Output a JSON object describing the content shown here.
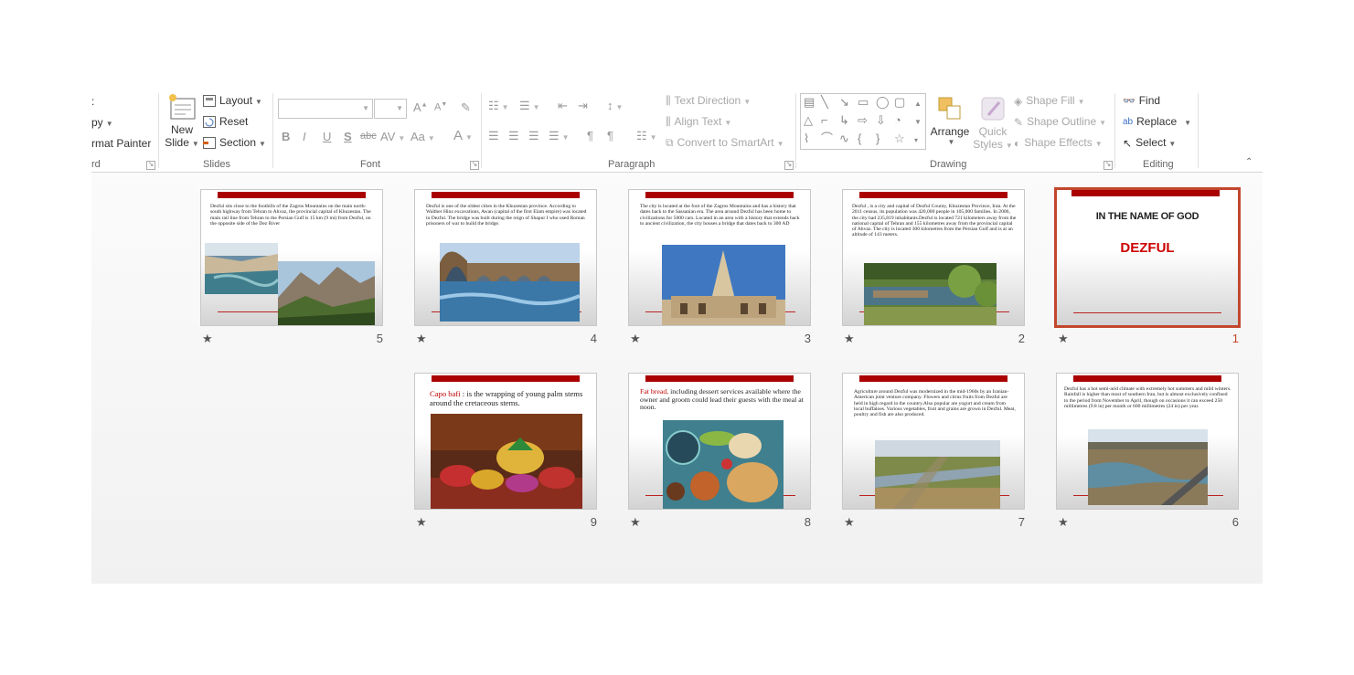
{
  "ribbon": {
    "clipboard": {
      "paste_frag": ":",
      "copy": "py",
      "format_painter": "rmat Painter",
      "label": "rd"
    },
    "slides": {
      "new_slide_line1": "New",
      "new_slide_line2": "Slide",
      "layout": "Layout",
      "reset": "Reset",
      "section": "Section",
      "label": "Slides"
    },
    "font": {
      "label": "Font",
      "buttons": [
        "B",
        "I",
        "U",
        "S",
        "abc",
        "AV",
        "Aa",
        "A"
      ]
    },
    "paragraph": {
      "text_direction": "Text Direction",
      "align_text": "Align Text",
      "convert_smartart": "Convert to SmartArt",
      "label": "Paragraph"
    },
    "drawing": {
      "arrange": "Arrange",
      "quick_styles_1": "Quick",
      "quick_styles_2": "Styles",
      "shape_fill": "Shape Fill",
      "shape_outline": "Shape Outline",
      "shape_effects": "Shape Effects",
      "label": "Drawing"
    },
    "editing": {
      "find": "Find",
      "replace": "Replace",
      "select": "Select",
      "label": "Editing"
    }
  },
  "slides": [
    {
      "number": "5",
      "text": "Dezful sits close to the foothills of the Zagros Mountains on the main north-south highway from Tehran to Ahvaz, the provincial capital of Khuzestan. The main rail line from Tehran to the Persian Gulf is 15 km (9 mi) from Dezful, on the opposite side of the Dez River"
    },
    {
      "number": "4",
      "text": "Dezful is one of the oldest cities in the Khuzestan province. According to Walther Hinz excavations, Awan (capital of the first Elam empire) was located in Dezful. The bridge was built during the reign of Shapur I who used Roman prisoners of war to build the bridge."
    },
    {
      "number": "3",
      "text": "The city is located at the foot of the Zagros Mountains and has a history that dates back to the Sassanian era. The area around Dezful has been home to civilizations for 5000 cars. Located in an area with a history that extends back to ancient civilization, the city houses a bridge that dates back to 300 AD"
    },
    {
      "number": "2",
      "text": "Dezful , is a city and capital of Dezful County, Khuzestan Province, Iran. At the 2011 census, its population was 420,000 people in 105,000 families. In 2006, the city had 235,819 inhabitants.Dezful is located 721 kilometers away from the national capital of Tehran and 155 kilometres away from the provincial capital of Ahvaz. The city is located 300 kilometres from the Persian Gulf and is at an altitude of 143 meters."
    },
    {
      "number": "1",
      "title": "IN THE NAME OF GOD",
      "subtitle": "DEZFUL"
    },
    {
      "number": "9",
      "lead": "Capo bafi",
      "text": " : is the wrapping of young palm stems around the cretaceous stems."
    },
    {
      "number": "8",
      "lead": "Fat bread,",
      "text": " including dessert services available where the owner and groom could lead their guests with the meal at noon."
    },
    {
      "number": "7",
      "text": "Agriculture around Dezful was modernized in the mid-1960s by an Iranian-American joint venture company. Flowers and citrus fruits from Dezful are held in high regard in the country.Also popular are yogurt and cream from local buffaloes. Various vegetables, fruit and grains are grown in Dezful. Meat, poultry and fish are also produced."
    },
    {
      "number": "6",
      "text": "Dezful has a hot semi-arid climate with extremely hot summers and mild winters. Rainfall is higher than most of southern Iran, but is almost exclusively confined to the period from November to April, though on occasions it can exceed 250 millimetres (9.8 in) per month or 600 millimetres (24 in) per year."
    }
  ],
  "star_symbol": "★",
  "colors": {
    "accent": "#aa0000",
    "selection": "#c2472d"
  }
}
